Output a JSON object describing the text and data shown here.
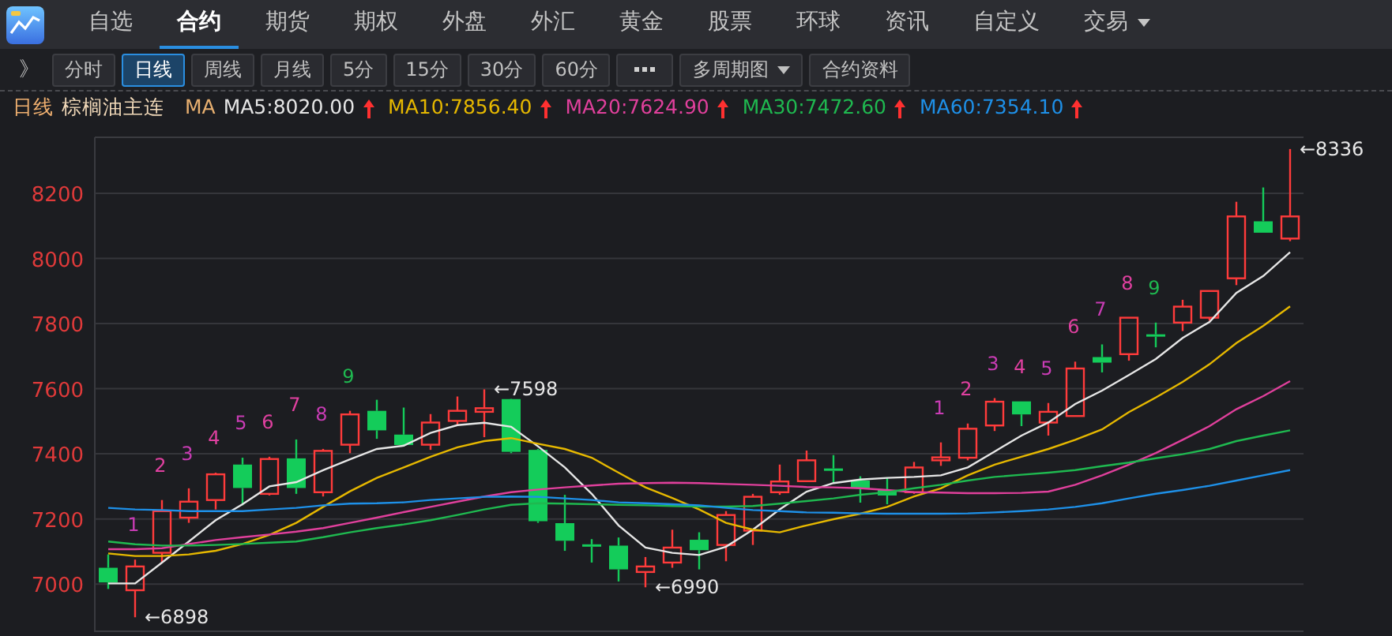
{
  "menu": {
    "tabs": [
      {
        "label": "自选",
        "selected": false
      },
      {
        "label": "合约",
        "selected": true
      },
      {
        "label": "期货",
        "selected": false
      },
      {
        "label": "期权",
        "selected": false
      },
      {
        "label": "外盘",
        "selected": false
      },
      {
        "label": "外汇",
        "selected": false
      },
      {
        "label": "黄金",
        "selected": false
      },
      {
        "label": "股票",
        "selected": false
      },
      {
        "label": "环球",
        "selected": false
      },
      {
        "label": "资讯",
        "selected": false
      },
      {
        "label": "自定义",
        "selected": false
      },
      {
        "label": "交易",
        "selected": false,
        "dropdown": true
      }
    ]
  },
  "toolbar": {
    "buttons": [
      {
        "kind": "expand",
        "label": "》",
        "selected": false
      },
      {
        "kind": "text",
        "label": "分时",
        "selected": false
      },
      {
        "kind": "text",
        "label": "日线",
        "selected": true
      },
      {
        "kind": "text",
        "label": "周线",
        "selected": false
      },
      {
        "kind": "text",
        "label": "月线",
        "selected": false
      },
      {
        "kind": "text",
        "label": "5分",
        "selected": false
      },
      {
        "kind": "text",
        "label": "15分",
        "selected": false
      },
      {
        "kind": "text",
        "label": "30分",
        "selected": false
      },
      {
        "kind": "text",
        "label": "60分",
        "selected": false
      },
      {
        "kind": "more",
        "selected": false
      },
      {
        "kind": "text",
        "label": "多周期图",
        "selected": false,
        "dropdown": true
      },
      {
        "kind": "text",
        "label": "合约资料",
        "selected": false
      }
    ]
  },
  "info_bar": {
    "period": "日线",
    "contract": "棕榈油主连",
    "indicator": "MA",
    "items": [
      {
        "value": ":8020.00",
        "rising": true
      },
      {
        "value": ":7856.40",
        "rising": true
      },
      {
        "value": ":7624.90",
        "rising": true
      },
      {
        "value": ":7472.60",
        "rising": true
      },
      {
        "value": ":7354.10",
        "rising": true
      }
    ]
  },
  "chart": {
    "chart_data": {
      "type": "candlestick",
      "grid": true,
      "ylim": [
        6855,
        8372
      ],
      "yticks": [
        7000,
        7200,
        7400,
        7600,
        7800,
        8000,
        8200
      ],
      "ohlc": [
        [
          7050,
          7091,
          6985,
          7005
        ],
        [
          6981,
          7075,
          6898,
          7054
        ],
        [
          7096,
          7258,
          7066,
          7224
        ],
        [
          7204,
          7294,
          7188,
          7253
        ],
        [
          7258,
          7342,
          7229,
          7337
        ],
        [
          7367,
          7388,
          7242,
          7295
        ],
        [
          7277,
          7391,
          7272,
          7384
        ],
        [
          7386,
          7444,
          7277,
          7295
        ],
        [
          7282,
          7415,
          7269,
          7409
        ],
        [
          7428,
          7532,
          7402,
          7521
        ],
        [
          7532,
          7566,
          7446,
          7472
        ],
        [
          7459,
          7542,
          7423,
          7427
        ],
        [
          7428,
          7522,
          7412,
          7496
        ],
        [
          7501,
          7576,
          7485,
          7532
        ],
        [
          7529,
          7598,
          7451,
          7540
        ],
        [
          7568,
          7569,
          7402,
          7406
        ],
        [
          7412,
          7415,
          7188,
          7193
        ],
        [
          7187,
          7274,
          7102,
          7133
        ],
        [
          7122,
          7138,
          7066,
          7115
        ],
        [
          7118,
          7143,
          7008,
          7045
        ],
        [
          7037,
          7083,
          6990,
          7054
        ],
        [
          7066,
          7167,
          7050,
          7112
        ],
        [
          7136,
          7159,
          7045,
          7104
        ],
        [
          7120,
          7224,
          7070,
          7212
        ],
        [
          7164,
          7277,
          7120,
          7268
        ],
        [
          7282,
          7367,
          7274,
          7315
        ],
        [
          7316,
          7410,
          7315,
          7380
        ],
        [
          7355,
          7396,
          7313,
          7349
        ],
        [
          7318,
          7331,
          7250,
          7294
        ],
        [
          7289,
          7326,
          7245,
          7272
        ],
        [
          7282,
          7375,
          7277,
          7358
        ],
        [
          7380,
          7435,
          7363,
          7389
        ],
        [
          7388,
          7493,
          7380,
          7477
        ],
        [
          7487,
          7571,
          7470,
          7560
        ],
        [
          7561,
          7561,
          7485,
          7521
        ],
        [
          7496,
          7556,
          7456,
          7529
        ],
        [
          7516,
          7683,
          7516,
          7662
        ],
        [
          7697,
          7736,
          7650,
          7680
        ],
        [
          7706,
          7818,
          7686,
          7818
        ],
        [
          7767,
          7803,
          7727,
          7764
        ],
        [
          7803,
          7873,
          7777,
          7852
        ],
        [
          7818,
          7900,
          7809,
          7900
        ],
        [
          7939,
          8174,
          7918,
          8129
        ],
        [
          8114,
          8218,
          8079,
          8079
        ],
        [
          8061,
          8336,
          8053,
          8129
        ]
      ],
      "series": [
        {
          "name": "MA5",
          "type": "line",
          "color": "#e6e6e6",
          "values": [
            7002,
            7002,
            7066,
            7131,
            7196,
            7245,
            7300,
            7313,
            7350,
            7383,
            7415,
            7425,
            7464,
            7488,
            7495,
            7483,
            7423,
            7358,
            7277,
            7180,
            7112,
            7096,
            7089,
            7115,
            7167,
            7229,
            7284,
            7310,
            7321,
            7326,
            7329,
            7334,
            7358,
            7407,
            7456,
            7496,
            7553,
            7594,
            7642,
            7691,
            7756,
            7805,
            7894,
            7946,
            8019
          ]
        },
        {
          "name": "MA10",
          "type": "line",
          "color": "#e6b800",
          "values": [
            7094,
            7086,
            7086,
            7091,
            7102,
            7123,
            7151,
            7188,
            7237,
            7285,
            7326,
            7358,
            7391,
            7420,
            7439,
            7448,
            7431,
            7415,
            7388,
            7342,
            7297,
            7264,
            7229,
            7188,
            7167,
            7159,
            7180,
            7199,
            7216,
            7237,
            7269,
            7294,
            7334,
            7367,
            7391,
            7415,
            7443,
            7475,
            7528,
            7573,
            7621,
            7675,
            7740,
            7793,
            7853
          ]
        },
        {
          "name": "MA20",
          "type": "line",
          "color": "#e0409c",
          "values": [
            7107,
            7107,
            7110,
            7123,
            7135,
            7144,
            7152,
            7161,
            7172,
            7188,
            7204,
            7221,
            7237,
            7253,
            7269,
            7282,
            7290,
            7297,
            7303,
            7308,
            7310,
            7311,
            7310,
            7307,
            7305,
            7302,
            7298,
            7297,
            7294,
            7289,
            7282,
            7281,
            7279,
            7279,
            7280,
            7284,
            7305,
            7334,
            7367,
            7402,
            7443,
            7485,
            7537,
            7577,
            7623
          ]
        },
        {
          "name": "MA30",
          "type": "line",
          "color": "#1fb950",
          "values": [
            7131,
            7122,
            7118,
            7118,
            7120,
            7123,
            7127,
            7131,
            7144,
            7159,
            7172,
            7183,
            7196,
            7212,
            7229,
            7243,
            7248,
            7247,
            7245,
            7243,
            7242,
            7240,
            7238,
            7238,
            7240,
            7247,
            7255,
            7263,
            7274,
            7282,
            7294,
            7305,
            7318,
            7329,
            7336,
            7342,
            7350,
            7362,
            7373,
            7386,
            7399,
            7415,
            7439,
            7456,
            7472
          ]
        },
        {
          "name": "MA60",
          "type": "line",
          "color": "#1e90e8",
          "values": [
            7234,
            7229,
            7227,
            7224,
            7224,
            7224,
            7229,
            7234,
            7242,
            7247,
            7248,
            7251,
            7258,
            7263,
            7268,
            7269,
            7268,
            7263,
            7258,
            7251,
            7248,
            7245,
            7242,
            7234,
            7227,
            7224,
            7220,
            7219,
            7217,
            7216,
            7216,
            7216,
            7217,
            7220,
            7224,
            7229,
            7237,
            7248,
            7263,
            7277,
            7289,
            7302,
            7318,
            7334,
            7350
          ]
        }
      ],
      "annotations": [
        {
          "y": 7075,
          "text": "1"
        },
        {
          "y": 7258,
          "text": "2"
        },
        {
          "y": 7294,
          "text": "3"
        },
        {
          "y": 7342,
          "text": "4"
        },
        {
          "y": 7388,
          "text": "5"
        },
        {
          "y": 7391,
          "text": "6"
        },
        {
          "y": 7444,
          "text": "7"
        },
        {
          "y": 7415,
          "text": "8"
        },
        {
          "y": 7532,
          "text": "9"
        },
        {
          "y": 7435,
          "text": "1"
        },
        {
          "y": 7493,
          "text": "2"
        },
        {
          "y": 7571,
          "text": "3"
        },
        {
          "y": 7561,
          "text": "4"
        },
        {
          "y": 7556,
          "text": "5"
        },
        {
          "y": 7683,
          "text": "6"
        },
        {
          "y": 7736,
          "text": "7"
        },
        {
          "y": 7818,
          "text": "8"
        },
        {
          "y": 7803,
          "text": "9"
        },
        "←6898",
        "←7598",
        "←6990",
        "←8336"
      ]
    },
    "annotation_styles": [
      {
        "kind": "count",
        "color": "#c83cb4"
      },
      {
        "kind": "count",
        "color": "#e040a0"
      },
      {
        "kind": "count",
        "color": "#c83cb4"
      },
      {
        "kind": "count",
        "color": "#e040a0"
      },
      {
        "kind": "count",
        "color": "#c83cb4"
      },
      {
        "kind": "count",
        "color": "#e040a0"
      },
      {
        "kind": "count",
        "color": "#e040a0"
      },
      {
        "kind": "count",
        "color": "#c83cb4"
      },
      {
        "kind": "count",
        "color": "#1fb950"
      },
      {
        "kind": "count",
        "color": "#c83cb4"
      },
      {
        "kind": "count",
        "color": "#e040a0"
      },
      {
        "kind": "count",
        "color": "#c83cb4"
      },
      {
        "kind": "count",
        "color": "#e040a0"
      },
      {
        "kind": "count",
        "color": "#c83cb4"
      },
      {
        "kind": "count",
        "color": "#e040a0"
      },
      {
        "kind": "count",
        "color": "#c83cb4"
      },
      {
        "kind": "count",
        "color": "#e040a0"
      },
      {
        "kind": "count",
        "color": "#1fb950"
      },
      {
        "kind": "extreme",
        "color": "#e8e8e8"
      },
      {
        "kind": "extreme",
        "color": "#e8e8e8"
      },
      {
        "kind": "extreme",
        "color": "#e8e8e8"
      },
      {
        "kind": "extreme",
        "color": "#e8e8e8"
      }
    ]
  }
}
